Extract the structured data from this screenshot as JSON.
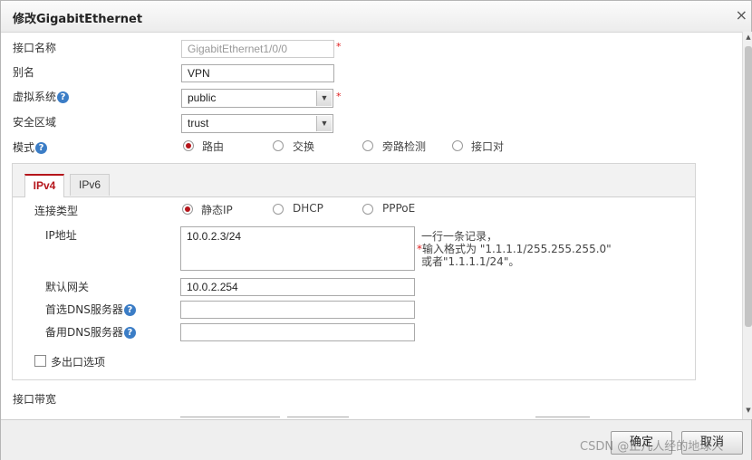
{
  "dialog": {
    "title": "修改GigabitEthernet",
    "close_glyph": "×"
  },
  "form": {
    "interface_name": {
      "label": "接口名称",
      "value": "GigabitEthernet1/0/0",
      "required_mark": "*"
    },
    "alias": {
      "label": "别名",
      "value": "VPN"
    },
    "vsys": {
      "label": "虚拟系统",
      "help": "?",
      "value": "public",
      "required_mark": "*"
    },
    "zone": {
      "label": "安全区域",
      "value": "trust"
    },
    "mode": {
      "label": "模式",
      "help": "?",
      "options": [
        "路由",
        "交换",
        "旁路检测",
        "接口对"
      ],
      "selected": "路由"
    }
  },
  "tabs": [
    {
      "label": "IPv4",
      "active": true
    },
    {
      "label": "IPv6",
      "active": false
    }
  ],
  "ipv4": {
    "conn_type": {
      "label": "连接类型",
      "options": [
        "静态IP",
        "DHCP",
        "PPPoE"
      ],
      "selected": "静态IP"
    },
    "ip": {
      "label": "IP地址",
      "value": "10.0.2.3/24",
      "hint_line1": "一行一条记录，",
      "hint_star": "*",
      "hint_line2": "输入格式为 \"1.1.1.1/255.255.255.0\"",
      "hint_line3": "或者\"1.1.1.1/24\"。"
    },
    "gateway": {
      "label": "默认网关",
      "value": "10.0.2.254"
    },
    "dns1": {
      "label": "首选DNS服务器",
      "help": "?",
      "value": ""
    },
    "dns2": {
      "label": "备用DNS服务器",
      "help": "?",
      "value": ""
    },
    "multi_exit": {
      "label": "多出口选项",
      "checked": false
    }
  },
  "bandwidth": {
    "label": "接口带宽"
  },
  "footer": {
    "ok": "确定",
    "cancel": "取消"
  },
  "watermark": "CSDN @正凡人经的地球人",
  "colors": {
    "accent": "#b5151b",
    "help": "#3b7dc6",
    "required": "#e02020"
  },
  "icons": [
    "close-icon",
    "help-icon",
    "chevron-down-icon",
    "scroll-up-icon",
    "scroll-down-icon"
  ]
}
